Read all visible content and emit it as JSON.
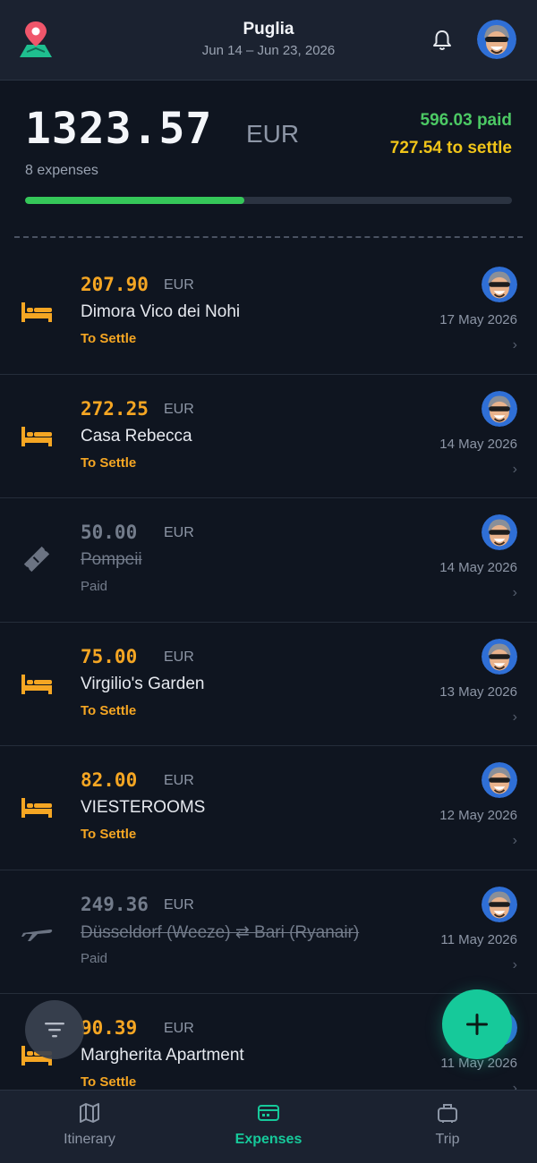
{
  "header": {
    "title": "Puglia",
    "dates": "Jun 14 – Jun 23, 2026",
    "icons": {
      "logo": "map-pin-logo-icon",
      "bell": "bell-icon",
      "avatar": "user-avatar"
    }
  },
  "summary": {
    "total": "1323.57",
    "currency": "EUR",
    "count": "8 expenses",
    "paid": "596.03 paid",
    "to_settle": "727.54 to settle",
    "progress_fraction": 0.45
  },
  "expenses": [
    {
      "amount": "207.90",
      "currency": "EUR",
      "name": "Dimora Vico dei Nohi",
      "status": "To Settle",
      "date": "17 May 2026",
      "category": "bed-icon",
      "paid": false
    },
    {
      "amount": "272.25",
      "currency": "EUR",
      "name": "Casa Rebecca",
      "status": "To Settle",
      "date": "14 May 2026",
      "category": "bed-icon",
      "paid": false
    },
    {
      "amount": "50.00",
      "currency": "EUR",
      "name": "Pompeii",
      "status": "Paid",
      "date": "14 May 2026",
      "category": "ticket-icon",
      "paid": true
    },
    {
      "amount": "75.00",
      "currency": "EUR",
      "name": "Virgilio's Garden",
      "status": "To Settle",
      "date": "13 May 2026",
      "category": "bed-icon",
      "paid": false
    },
    {
      "amount": "82.00",
      "currency": "EUR",
      "name": "VIESTEROOMS",
      "status": "To Settle",
      "date": "12 May 2026",
      "category": "bed-icon",
      "paid": false
    },
    {
      "amount": "249.36",
      "currency": "EUR",
      "name": "Düsseldorf (Weeze) ⇄ Bari (Ryanair)",
      "status": "Paid",
      "date": "11 May 2026",
      "category": "plane-icon",
      "paid": true
    },
    {
      "amount": "90.39",
      "currency": "EUR",
      "name": "Margherita Apartment",
      "status": "To Settle",
      "date": "11 May 2026",
      "category": "bed-icon",
      "paid": false
    }
  ],
  "fab": {
    "filter": "filter-icon",
    "add": "plus-icon"
  },
  "nav": [
    {
      "label": "Itinerary",
      "icon": "map-icon",
      "active": false
    },
    {
      "label": "Expenses",
      "icon": "credit-card-icon",
      "active": true
    },
    {
      "label": "Trip",
      "icon": "suitcase-icon",
      "active": false
    }
  ],
  "colors": {
    "background": "#0f1520",
    "header": "#1b2230",
    "accent": "#16c99a",
    "to_settle": "#f5a623",
    "paid": "#4cc964",
    "settle_total": "#f0c419"
  }
}
